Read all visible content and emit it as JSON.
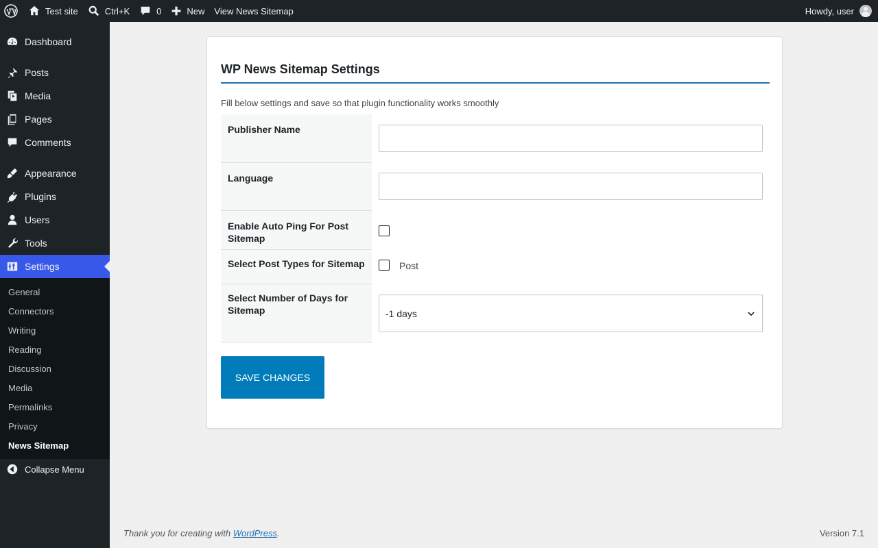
{
  "adminbar": {
    "site_name": "Test site",
    "search_shortcut": "Ctrl+K",
    "comments_count": "0",
    "new_label": "New",
    "view_link": "View News Sitemap",
    "howdy": "Howdy, user"
  },
  "sidebar": {
    "menu": {
      "dashboard": "Dashboard",
      "posts": "Posts",
      "media": "Media",
      "pages": "Pages",
      "comments": "Comments",
      "appearance": "Appearance",
      "plugins": "Plugins",
      "users": "Users",
      "tools": "Tools",
      "settings": "Settings",
      "collapse": "Collapse Menu"
    },
    "submenu": [
      "General",
      "Connectors",
      "Writing",
      "Reading",
      "Discussion",
      "Media",
      "Permalinks",
      "Privacy",
      "News Sitemap"
    ],
    "current_submenu": "News Sitemap"
  },
  "page": {
    "title": "WP News Sitemap Settings",
    "description": "Fill below settings and save so that plugin functionality works smoothly",
    "fields": {
      "publisher_name": {
        "label": "Publisher Name",
        "value": "",
        "placeholder": ""
      },
      "language": {
        "label": "Language",
        "value": "",
        "placeholder": ""
      },
      "auto_ping": {
        "label": "Enable Auto Ping For Post Sitemap",
        "checked": false
      },
      "post_types": {
        "label": "Select Post Types for Sitemap",
        "option_label": "Post",
        "checked": false
      },
      "days": {
        "label": "Select Number of Days for Sitemap",
        "selected": "-1 days"
      }
    },
    "save_label": "SAVE CHANGES"
  },
  "footer": {
    "thanks_prefix": "Thank you for creating with ",
    "thanks_link": "WordPress",
    "thanks_suffix": ".",
    "version": "Version 7.1"
  },
  "colors": {
    "adminbar_bg": "#1d2327",
    "active_menu": "#3858e9",
    "primary_button": "#007cba",
    "title_rule": "#2271b1"
  }
}
